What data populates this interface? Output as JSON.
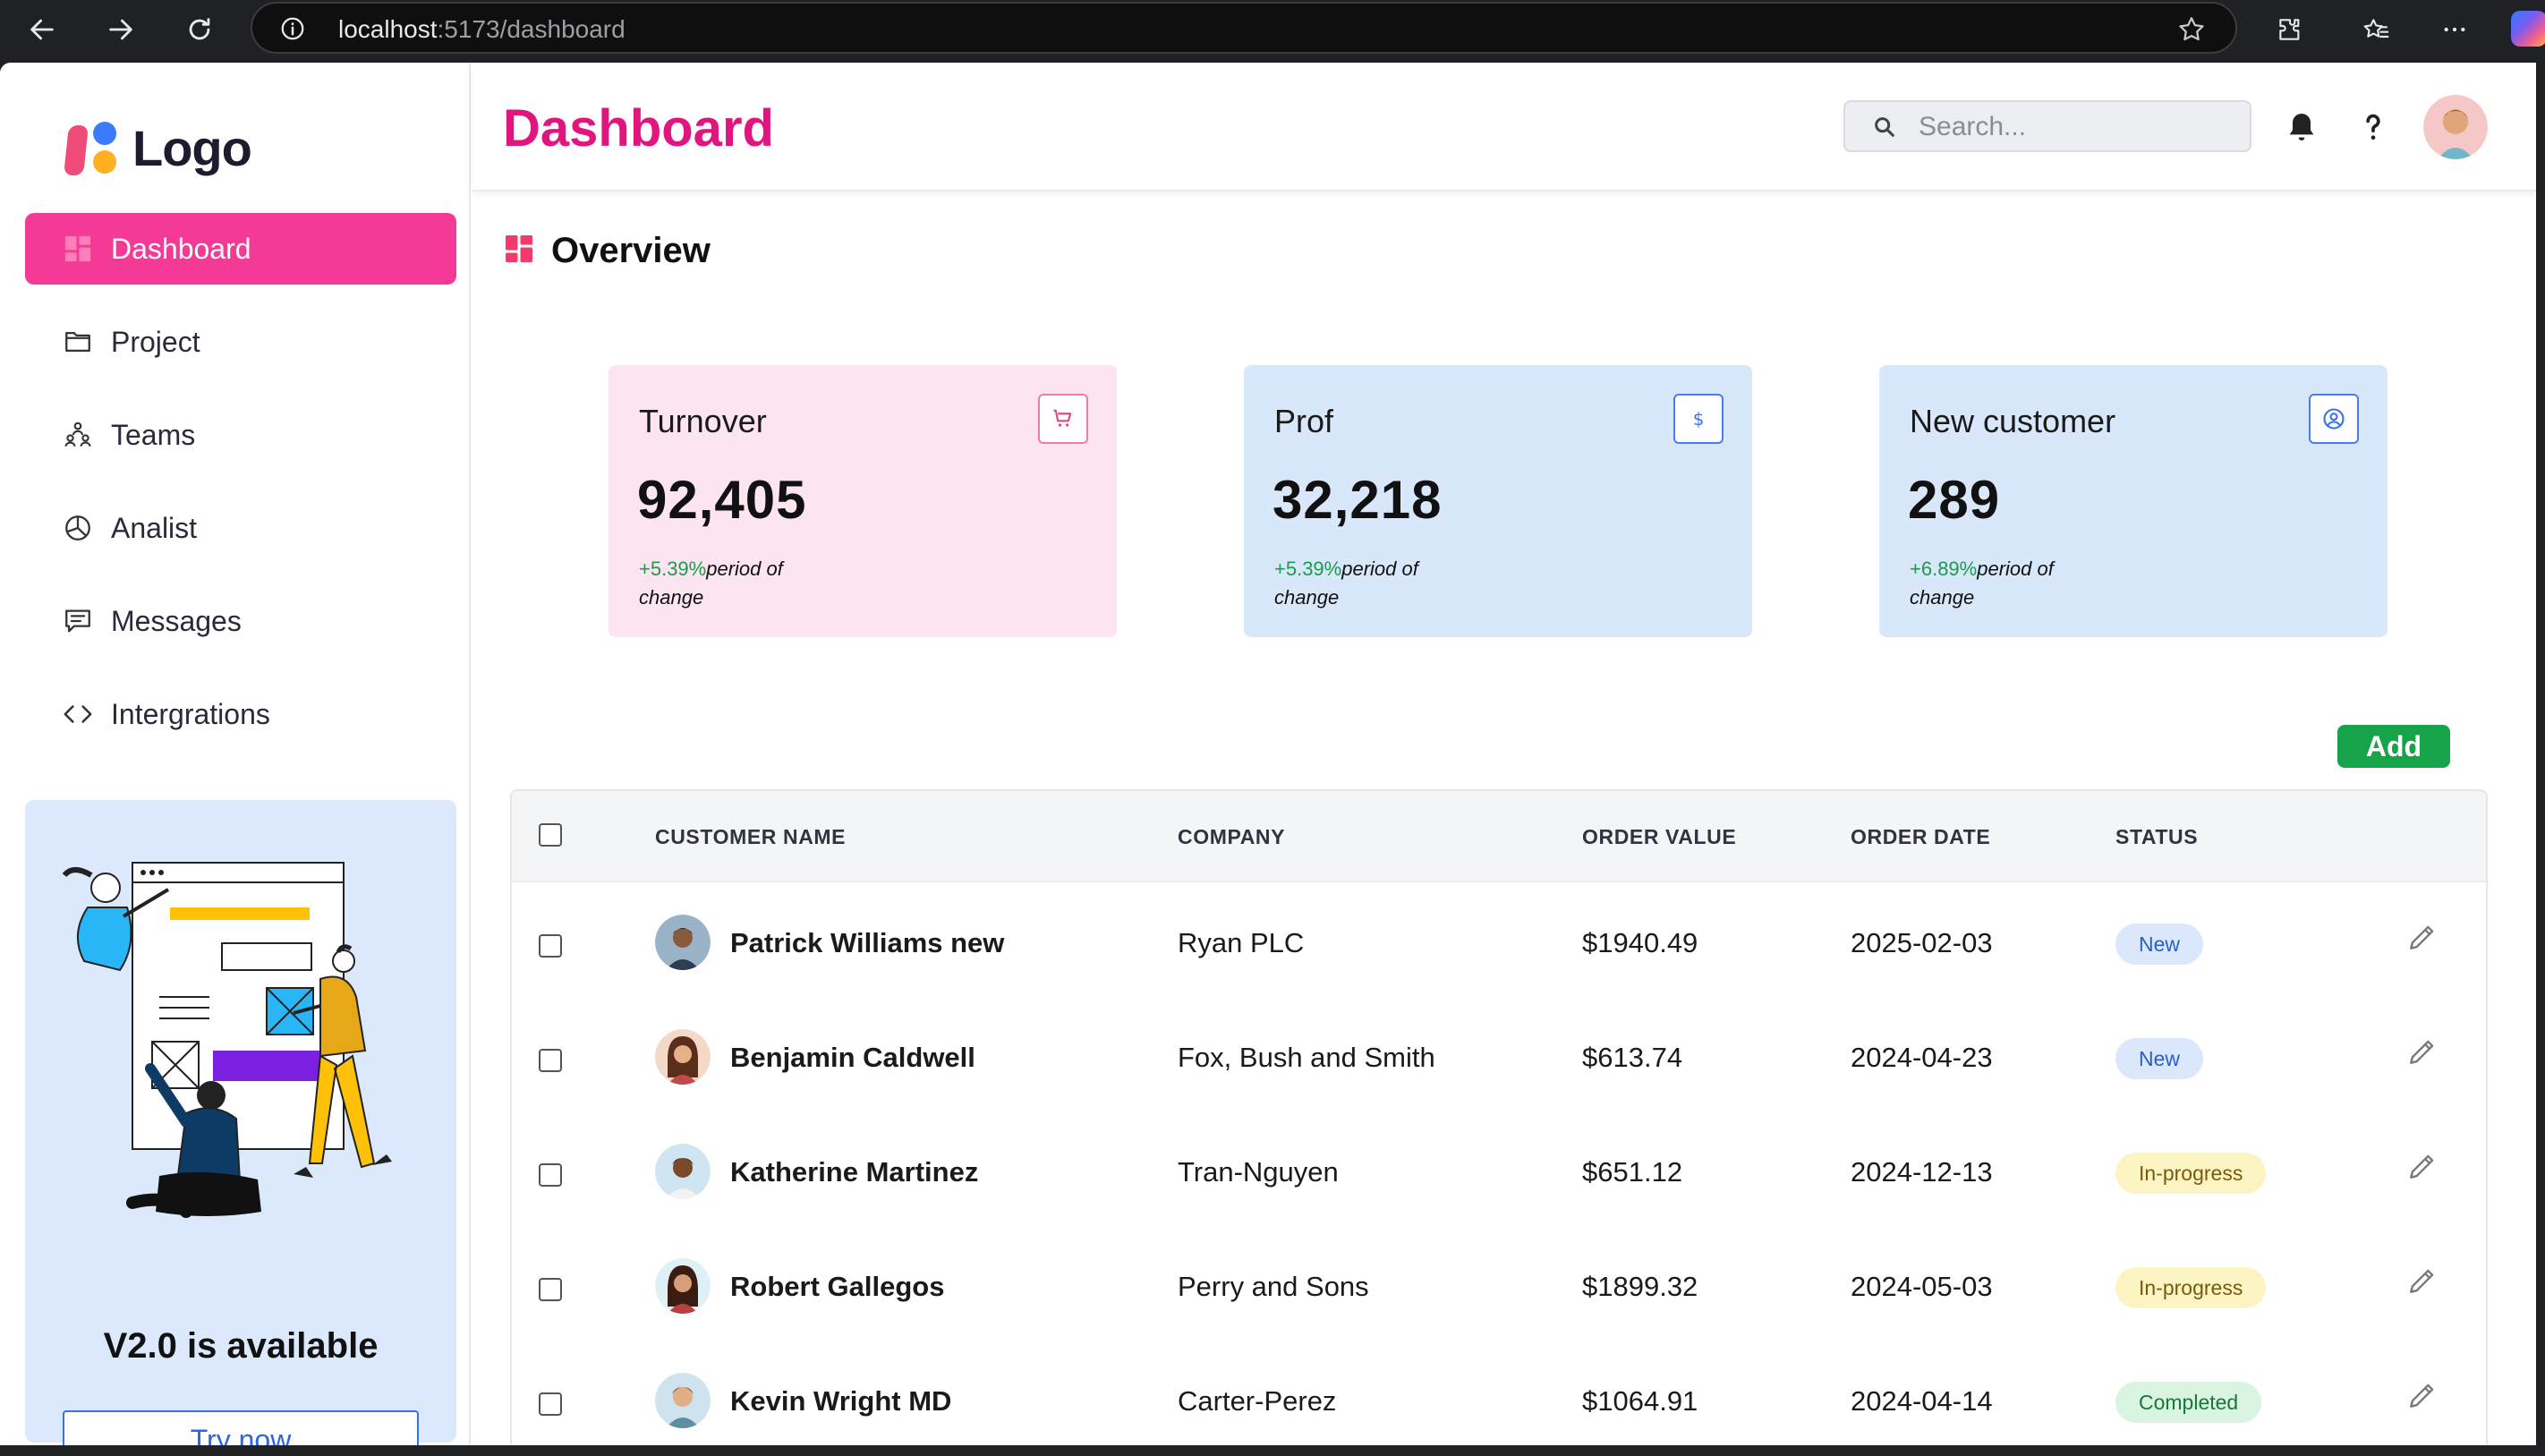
{
  "browser": {
    "url_host": "localhost",
    "url_path": ":5173/dashboard"
  },
  "logo": {
    "text": "Logo"
  },
  "sidebar": {
    "items": [
      {
        "label": "Dashboard",
        "icon": "dashboard-grid-icon",
        "active": true
      },
      {
        "label": "Project",
        "icon": "folder-icon"
      },
      {
        "label": "Teams",
        "icon": "teams-icon"
      },
      {
        "label": "Analist",
        "icon": "pie-chart-icon"
      },
      {
        "label": "Messages",
        "icon": "message-icon"
      },
      {
        "label": "Intergrations",
        "icon": "code-brackets-icon"
      }
    ],
    "promo": {
      "title": "V2.0 is available",
      "button": "Try now"
    }
  },
  "header": {
    "title": "Dashboard",
    "search_placeholder": "Search..."
  },
  "overview": {
    "title": "Overview",
    "cards": [
      {
        "label": "Turnover",
        "value": "92,405",
        "change": "+5.39%",
        "note": "period of change",
        "icon": "cart-icon",
        "color": "#fce4f1"
      },
      {
        "label": "Prof",
        "value": "32,218",
        "change": "+5.39%",
        "note": "period of change",
        "icon": "dollar-icon",
        "color": "#d9e7fb"
      },
      {
        "label": "New customer",
        "value": "289",
        "change": "+6.89%",
        "note": "period of change",
        "icon": "user-circle-icon",
        "color": "#d9e7fb"
      }
    ]
  },
  "add_button": "Add",
  "table": {
    "columns": [
      "CUSTOMER NAME",
      "COMPANY",
      "ORDER VALUE",
      "ORDER DATE",
      "STATUS"
    ],
    "rows": [
      {
        "name": "Patrick Williams new",
        "company": "Ryan PLC",
        "value": "$1940.49",
        "date": "2025-02-03",
        "status": "New"
      },
      {
        "name": "Benjamin Caldwell",
        "company": "Fox, Bush and Smith",
        "value": "$613.74",
        "date": "2024-04-23",
        "status": "New"
      },
      {
        "name": "Katherine Martinez",
        "company": "Tran-Nguyen",
        "value": "$651.12",
        "date": "2024-12-13",
        "status": "In-progress"
      },
      {
        "name": "Robert Gallegos",
        "company": "Perry and Sons",
        "value": "$1899.32",
        "date": "2024-05-03",
        "status": "In-progress"
      },
      {
        "name": "Kevin Wright MD",
        "company": "Carter-Perez",
        "value": "$1064.91",
        "date": "2024-04-14",
        "status": "Completed"
      }
    ]
  },
  "colors": {
    "accent": "#f43a96",
    "title": "#e0157e",
    "add_button": "#16a34a"
  }
}
